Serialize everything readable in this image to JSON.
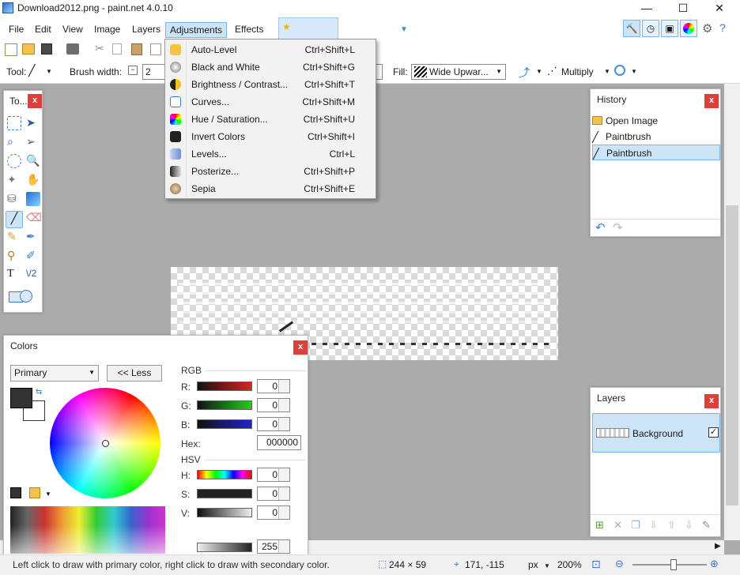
{
  "window": {
    "title": "Download2012.png - paint.net 4.0.10",
    "minimize": "—",
    "maximize": "☐",
    "close": "✕"
  },
  "menubar": {
    "items": [
      "File",
      "Edit",
      "View",
      "Image",
      "Layers",
      "Adjustments",
      "Effects"
    ],
    "active": "Adjustments"
  },
  "toolbar2": {
    "tool_label": "Tool:",
    "brush_width_label": "Brush width:",
    "brush_width_value": "2",
    "fill_label": "Fill:",
    "fill_value": "Wide Upwar...",
    "blend_mode": "Multiply"
  },
  "adjustments_menu": [
    {
      "label": "Auto-Level",
      "shortcut": "Ctrl+Shift+L",
      "icon": "auto-level-icon",
      "color": "#f4c542"
    },
    {
      "label": "Black and White",
      "shortcut": "Ctrl+Shift+G",
      "icon": "black-white-icon",
      "color": "#8a8a8a"
    },
    {
      "label": "Brightness / Contrast...",
      "shortcut": "Ctrl+Shift+T",
      "icon": "brightness-icon",
      "color": "#e9b21a"
    },
    {
      "label": "Curves...",
      "shortcut": "Ctrl+Shift+M",
      "icon": "curves-icon",
      "color": "#3b7bd6"
    },
    {
      "label": "Hue / Saturation...",
      "shortcut": "Ctrl+Shift+U",
      "icon": "hue-saturation-icon",
      "color": "#b24fbf"
    },
    {
      "label": "Invert Colors",
      "shortcut": "Ctrl+Shift+I",
      "icon": "invert-colors-icon",
      "color": "#222222"
    },
    {
      "label": "Levels...",
      "shortcut": "Ctrl+L",
      "icon": "levels-icon",
      "color": "#6c8fcf"
    },
    {
      "label": "Posterize...",
      "shortcut": "Ctrl+Shift+P",
      "icon": "posterize-icon",
      "color": "#555555"
    },
    {
      "label": "Sepia",
      "shortcut": "Ctrl+Shift+E",
      "icon": "sepia-icon",
      "color": "#a07a4f"
    }
  ],
  "tools_panel": {
    "title": "To...",
    "close": "x"
  },
  "history": {
    "title": "History",
    "close": "x",
    "items": [
      {
        "label": "Open Image",
        "icon": "folder-icon"
      },
      {
        "label": "Paintbrush",
        "icon": "paintbrush-icon"
      },
      {
        "label": "Paintbrush",
        "icon": "paintbrush-icon"
      }
    ],
    "selected_index": 2
  },
  "layers": {
    "title": "Layers",
    "close": "x",
    "items": [
      {
        "label": "Background",
        "visible": true
      }
    ]
  },
  "colors": {
    "title": "Colors",
    "close": "x",
    "mode": "Primary",
    "less_button": "<< Less",
    "rgb_header": "RGB",
    "hsv_header": "HSV",
    "r_label": "R:",
    "r_value": "0",
    "g_label": "G:",
    "g_value": "0",
    "b_label": "B:",
    "b_value": "0",
    "hex_label": "Hex:",
    "hex_value": "000000",
    "h_label": "H:",
    "h_value": "0",
    "s_label": "S:",
    "s_value": "0",
    "v_label": "V:",
    "v_value": "0",
    "alpha_value": "255",
    "primary_color": "#333333",
    "secondary_color": "#ffffff"
  },
  "statusbar": {
    "hint": "Left click to draw with primary color, right click to draw with secondary color.",
    "image_size": "244 × 59",
    "cursor_pos": "171, -115",
    "unit": "px",
    "zoom": "200%"
  },
  "accent_color": "#cce4f7"
}
